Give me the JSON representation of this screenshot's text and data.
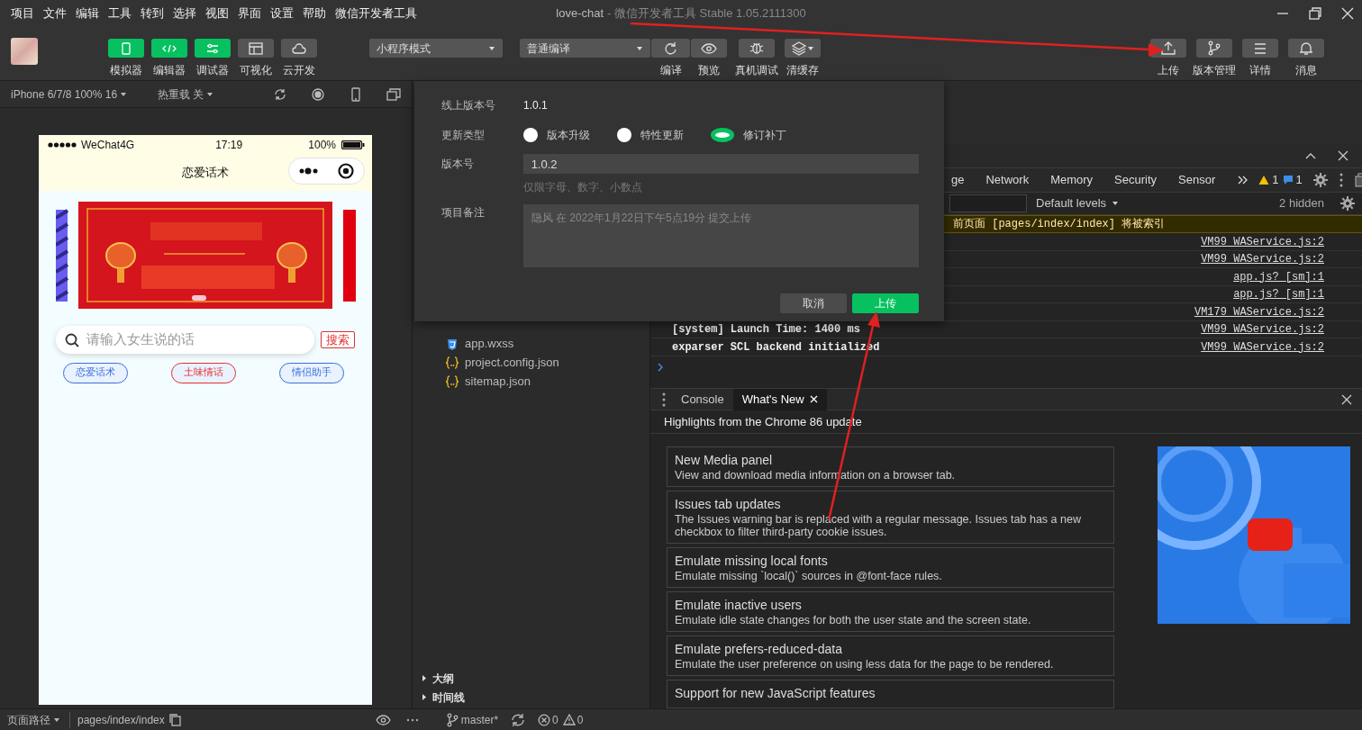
{
  "menu_bar": {
    "items": [
      "项目",
      "文件",
      "编辑",
      "工具",
      "转到",
      "选择",
      "视图",
      "界面",
      "设置",
      "帮助",
      "微信开发者工具"
    ],
    "project_name": "love-chat",
    "app_title": "- 微信开发者工具 Stable 1.05.2111300"
  },
  "toolbar": {
    "view_toggles": [
      {
        "label": "模拟器",
        "on": true
      },
      {
        "label": "编辑器",
        "on": true
      },
      {
        "label": "调试器",
        "on": true
      },
      {
        "label": "可视化",
        "on": false
      },
      {
        "label": "云开发",
        "on": false
      }
    ],
    "mode_select": "小程序模式",
    "compile_select": "普通编译",
    "compile_actions": [
      "编译",
      "预览"
    ],
    "debug_actions": [
      "真机调试",
      "清缓存"
    ],
    "right_actions": [
      "上传",
      "版本管理",
      "详情",
      "消息"
    ]
  },
  "simulator": {
    "device": "iPhone 6/7/8 100% 16",
    "hot_reload": "热重载 关",
    "phone": {
      "carrier": "WeChat4G",
      "time": "17:19",
      "battery": "100%",
      "title": "恋爱话术",
      "search_placeholder": "请输入女生说的话",
      "search_button": "搜索",
      "tags": [
        {
          "label": "恋爱话术",
          "color": "#3a6fd8"
        },
        {
          "label": "土味情话",
          "color": "#e03030"
        },
        {
          "label": "情侣助手",
          "color": "#3a6fd8"
        }
      ]
    }
  },
  "upload_dialog": {
    "fields": [
      {
        "kind": "text",
        "label": "线上版本号",
        "value": "1.0.1"
      },
      {
        "kind": "radio",
        "label": "更新类型",
        "options": [
          {
            "label": "版本升级",
            "selected": false
          },
          {
            "label": "特性更新",
            "selected": false
          },
          {
            "label": "修订补丁",
            "selected": true
          }
        ]
      },
      {
        "kind": "input",
        "label": "版本号",
        "value": "1.0.2",
        "hint": "仅限字母、数字、小数点"
      },
      {
        "kind": "textarea",
        "label": "项目备注",
        "placeholder": "隐风 在 2022年1月22日下午5点19分 提交上传"
      }
    ],
    "buttons": [
      {
        "label": "取消",
        "kind": "secondary"
      },
      {
        "label": "上传",
        "kind": "primary"
      }
    ]
  },
  "file_tree": [
    {
      "name": "app.wxss",
      "kind": "css"
    },
    {
      "name": "project.config.json",
      "kind": "json"
    },
    {
      "name": "sitemap.json",
      "kind": "json"
    }
  ],
  "outline_sections": [
    "大纲",
    "时间线"
  ],
  "devtools": {
    "tabs": [
      "ge",
      "Network",
      "Memory",
      "Security",
      "Sensor"
    ],
    "warning_count": "1",
    "message_count": "1",
    "level_filter": "Default levels",
    "hidden_count": "2 hidden",
    "console_rows": [
      {
        "kind": "warning",
        "message": "前页面 [pages/index/index] 将被索引"
      },
      {
        "kind": "log",
        "source": "VM99 WAService.js:2"
      },
      {
        "kind": "log",
        "source": "VM99 WAService.js:2"
      },
      {
        "kind": "log",
        "source": "app.js? [sm]:1"
      },
      {
        "kind": "log",
        "source": "app.js? [sm]:1"
      },
      {
        "kind": "log",
        "source": "VM179 WAService.js:2"
      },
      {
        "kind": "log",
        "message": "[system] Launch Time: 1400 ms",
        "source": "VM99 WAService.js:2"
      },
      {
        "kind": "log",
        "message": "exparser SCL backend initialized",
        "source": "VM99 WAService.js:2"
      }
    ],
    "drawer_tabs": [
      {
        "label": "Console",
        "selected": false
      },
      {
        "label": "What's New",
        "selected": true
      }
    ],
    "headline": "Highlights from the Chrome 86 update",
    "highlights": [
      {
        "title": "New Media panel",
        "description": "View and download media information on a browser tab."
      },
      {
        "title": "Issues tab updates",
        "description": "The Issues warning bar is replaced with a regular message. Issues tab has a new checkbox to filter third-party cookie issues."
      },
      {
        "title": "Emulate missing local fonts",
        "description": "Emulate missing `local()` sources in @font-face rules."
      },
      {
        "title": "Emulate inactive users",
        "description": "Emulate idle state changes for both the user state and the screen state."
      },
      {
        "title": "Emulate prefers-reduced-data",
        "description": "Emulate the user preference on using less data for the page to be rendered."
      },
      {
        "title": "Support for new JavaScript features"
      }
    ]
  },
  "status_bar": {
    "path_label": "页面路径",
    "path": "pages/index/index",
    "branch": "master*",
    "errors": "0",
    "warnings": "0"
  }
}
